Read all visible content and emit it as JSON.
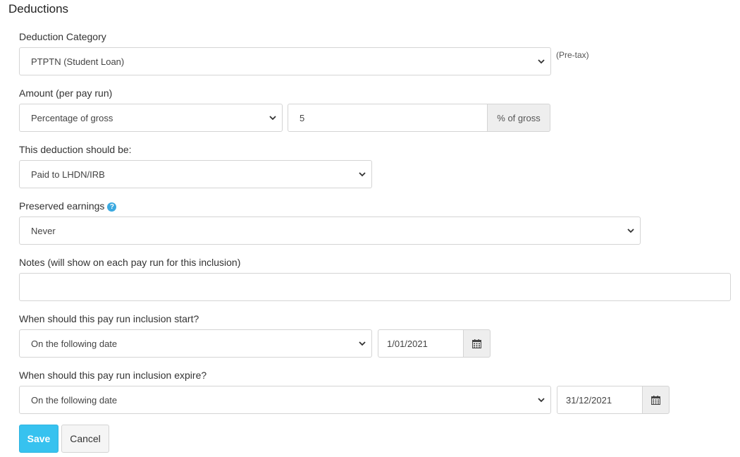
{
  "section_title": "Deductions",
  "deduction_category": {
    "label": "Deduction Category",
    "value": "PTPTN (Student Loan)",
    "note": "(Pre-tax)"
  },
  "amount": {
    "label": "Amount (per pay run)",
    "type_value": "Percentage of gross",
    "value": "5",
    "unit": "% of gross"
  },
  "payment_destination": {
    "label": "This deduction should be:",
    "value": "Paid to LHDN/IRB"
  },
  "preserved_earnings": {
    "label": "Preserved earnings",
    "help_icon": "question-circle-icon",
    "value": "Never"
  },
  "notes": {
    "label": "Notes (will show on each pay run for this inclusion)",
    "value": ""
  },
  "start": {
    "label": "When should this pay run inclusion start?",
    "mode": "On the following date",
    "date": "1/01/2021",
    "icon": "calendar-icon"
  },
  "expire": {
    "label": "When should this pay run inclusion expire?",
    "mode": "On the following date",
    "date": "31/12/2021",
    "icon": "calendar-icon"
  },
  "buttons": {
    "save": "Save",
    "cancel": "Cancel"
  },
  "colors": {
    "primary": "#37c2ef",
    "help_icon": "#3ba9e0"
  }
}
